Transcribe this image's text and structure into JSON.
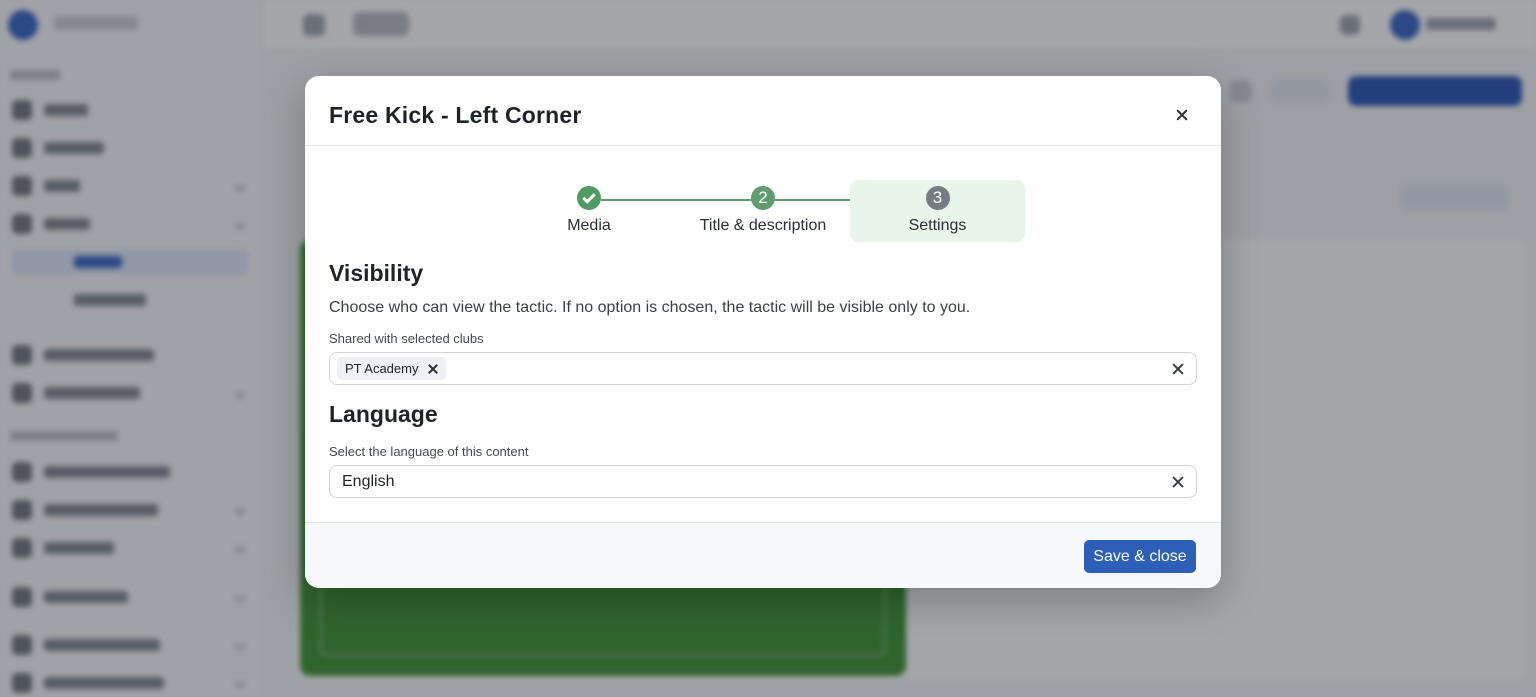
{
  "modal": {
    "title": "Free Kick - Left Corner",
    "stepper": {
      "steps": [
        {
          "label": "Media",
          "number": "1",
          "status": "completed"
        },
        {
          "label": "Title & description",
          "number": "2",
          "status": "completed"
        },
        {
          "label": "Settings",
          "number": "3",
          "status": "current"
        }
      ]
    },
    "visibility": {
      "heading": "Visibility",
      "description": "Choose who can view the tactic. If no option is chosen, the tactic will be visible only to you.",
      "field_label": "Shared with selected clubs",
      "chips": [
        "PT Academy"
      ]
    },
    "language": {
      "heading": "Language",
      "field_label": "Select the language of this content",
      "value": "English"
    },
    "footer": {
      "save_label": "Save & close"
    }
  },
  "colors": {
    "primary": "#2d5fb8",
    "step_done": "#4f9a62",
    "step_active_bg": "#e8f5ea",
    "overlay": "rgba(40,44,52,0.42)"
  }
}
